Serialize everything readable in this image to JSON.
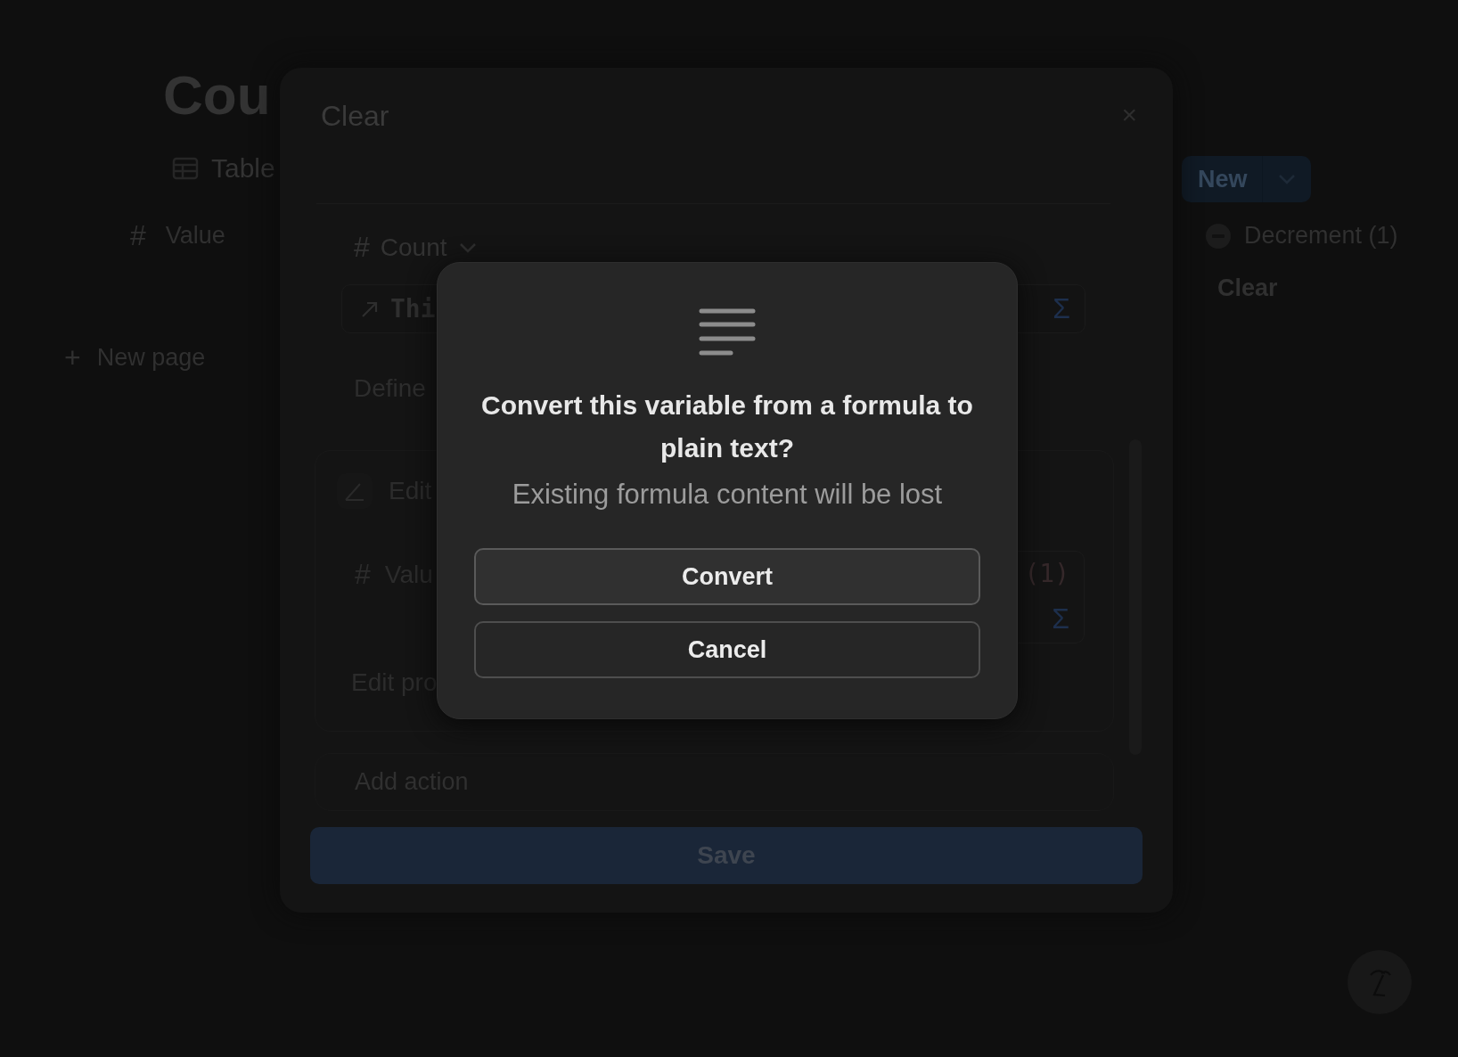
{
  "background_page": {
    "title": "Cou",
    "view_tab": "Table",
    "column": {
      "icon": "#",
      "label": "Value"
    },
    "new_page": {
      "icon": "+",
      "label": "New page"
    },
    "new_button": "New",
    "actions": [
      {
        "kind": "decrement",
        "label": "Decrement (1)"
      },
      {
        "kind": "plain",
        "label": "Clear"
      }
    ]
  },
  "edit_modal": {
    "title": "Clear",
    "close": "×",
    "property": {
      "icon": "#",
      "label": "Count"
    },
    "formula": {
      "text": "Thi",
      "sigma": "Σ"
    },
    "define_label": "Define",
    "action_card": {
      "label": "Edit",
      "property": {
        "icon": "#",
        "label": "Valu"
      },
      "formula": {
        "text": "(1)",
        "sigma": "Σ"
      },
      "footer": "Edit pro"
    },
    "add_action": "Add action",
    "save": "Save"
  },
  "confirm_dialog": {
    "title": "Convert this variable from a formula to plain text?",
    "message": "Existing formula content will be lost",
    "buttons": [
      {
        "label": "Convert",
        "primary": true
      },
      {
        "label": "Cancel",
        "primary": false
      }
    ]
  }
}
